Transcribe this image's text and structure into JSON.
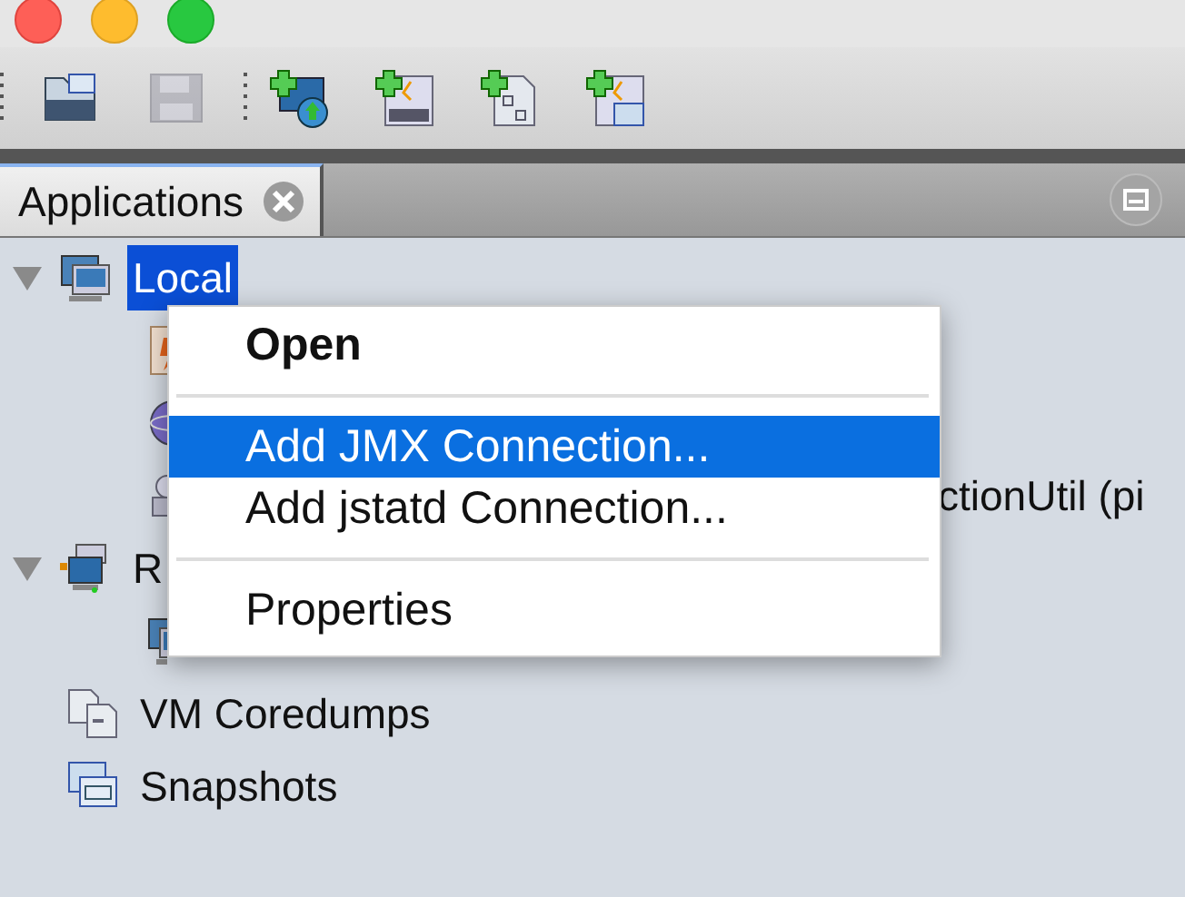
{
  "window": {
    "controls": [
      {
        "kind": "close"
      },
      {
        "kind": "minimize"
      },
      {
        "kind": "zoom"
      }
    ]
  },
  "toolbar": {
    "buttons": [
      {
        "kind": "open",
        "disabled": false
      },
      {
        "kind": "save",
        "disabled": true
      },
      {
        "kind": "add-remote",
        "disabled": false
      },
      {
        "kind": "add-jmx",
        "disabled": false
      },
      {
        "kind": "add-coredump",
        "disabled": false
      },
      {
        "kind": "add-snapshot",
        "disabled": false
      }
    ]
  },
  "tabs": [
    {
      "label": "Applications",
      "selected": true
    }
  ],
  "tree": [
    {
      "label": "Local",
      "kind": "host",
      "expanded": true,
      "selected": true,
      "children": [
        {
          "kind": "app"
        },
        {
          "kind": "service"
        },
        {
          "kind": "process",
          "label": "ctionUtil (pi"
        }
      ]
    },
    {
      "label": "R",
      "kind": "remote",
      "expanded": true,
      "selected": false,
      "children": [
        {
          "kind": "host"
        }
      ]
    },
    {
      "label": "VM Coredumps",
      "kind": "coredumps",
      "selected": false
    },
    {
      "label": "Snapshots",
      "kind": "snapshots",
      "selected": false
    }
  ],
  "context_menu": {
    "items": [
      {
        "kind": "item",
        "label": "Open",
        "default": true,
        "selected": false
      },
      {
        "kind": "separator"
      },
      {
        "kind": "item",
        "label": "Add JMX Connection...",
        "default": false,
        "selected": true
      },
      {
        "kind": "item",
        "label": "Add jstatd Connection...",
        "default": false,
        "selected": false
      },
      {
        "kind": "separator"
      },
      {
        "kind": "item",
        "label": "Properties",
        "default": false,
        "selected": false
      }
    ]
  }
}
